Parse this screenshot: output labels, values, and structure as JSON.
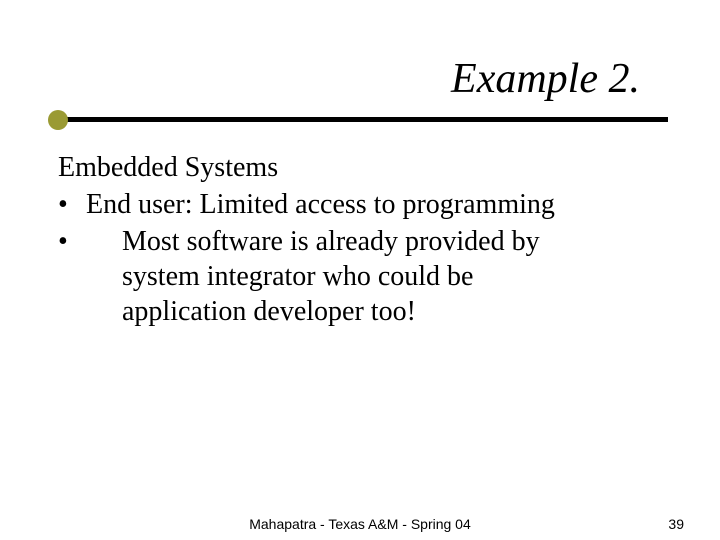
{
  "title": "Example 2.",
  "body": {
    "heading": "Embedded Systems",
    "bullet1": "End user: Limited access to programming",
    "bullet2": "Most software is already provided by system integrator who could be application developer too!"
  },
  "footer": {
    "center": "Mahapatra - Texas A&M - Spring 04",
    "page": "39"
  },
  "bullet_char": "•"
}
